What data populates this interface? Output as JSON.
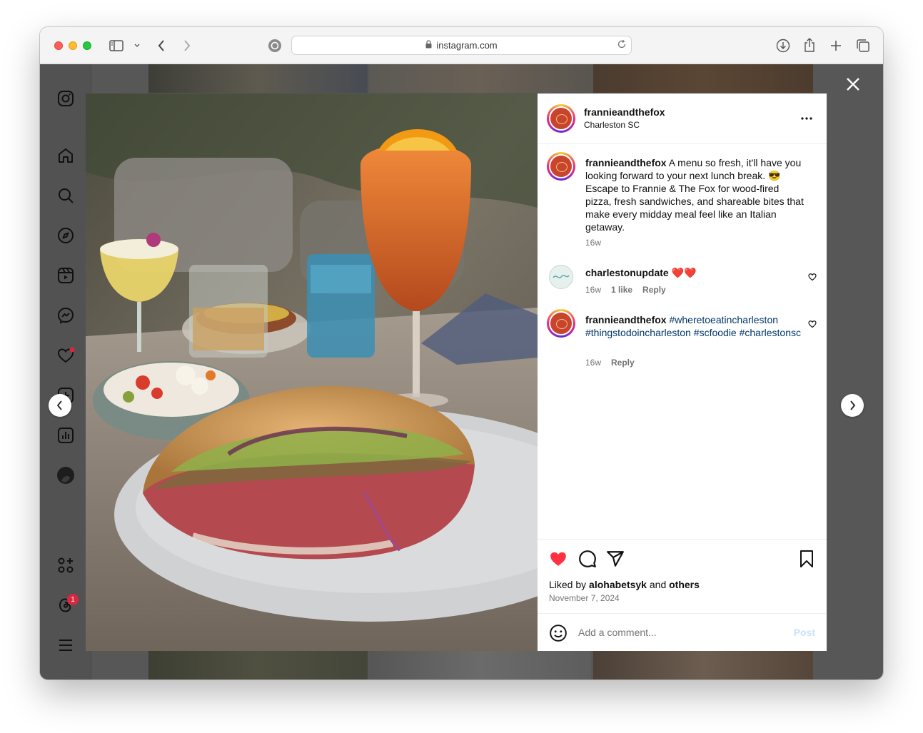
{
  "browser": {
    "url": "instagram.com"
  },
  "post": {
    "author": "frannieandthefox",
    "location": "Charleston SC",
    "caption_author": "frannieandthefox",
    "caption_text": " A menu so fresh, it'll have you looking forward to your next lunch break. 😎 Escape to Frannie & The Fox for wood-fired pizza, fresh sandwiches, and shareable bites that make every midday meal feel like an Italian getaway.",
    "caption_age": "16w",
    "comments": [
      {
        "author": "charlestonupdate",
        "text": " ❤️❤️",
        "age": "16w",
        "likes": "1 like",
        "reply": "Reply"
      },
      {
        "author": "frannieandthefox",
        "tags": [
          "#wheretoeatincharleston",
          "#thingstodoincharleston",
          "#scfoodie",
          "#charlestonsc"
        ],
        "age": "16w",
        "reply": "Reply"
      }
    ],
    "liked_by_prefix": "Liked by ",
    "liked_by_user": "alohabetsyk",
    "liked_by_and": " and ",
    "liked_by_others": "others",
    "date": "November 7, 2024",
    "comment_placeholder": "Add a comment...",
    "post_button": "Post"
  },
  "sidebar": {
    "notification_badge": "1"
  },
  "colors": {
    "like_red": "#ff3040",
    "link_blue": "#00376b",
    "post_button_disabled": "#c7e1fb"
  }
}
